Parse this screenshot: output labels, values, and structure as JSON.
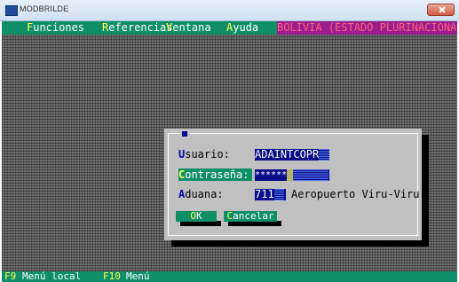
{
  "window": {
    "title": "MODBRILDE"
  },
  "menu": {
    "items": [
      {
        "hotkey": "F",
        "rest": "unciones"
      },
      {
        "hotkey": "R",
        "rest": "eferencias"
      },
      {
        "hotkey": "V",
        "rest": "entana"
      },
      {
        "hotkey": "A",
        "rest": "yuda"
      }
    ],
    "banner": "BOLIVIA (ESTADO PLURINACIONAL DE)"
  },
  "login": {
    "usuario_hotkey": "U",
    "usuario_label": "suario:",
    "usuario_value": "ADAINTCOPR",
    "contrasena_hotkey": "C",
    "contrasena_label": "ontraseña:",
    "contrasena_value": "******",
    "aduana_hotkey": "A",
    "aduana_label": "duana:",
    "aduana_code": "711",
    "aduana_name": "Aeropuerto Viru-Viru",
    "ok_hotkey": "O",
    "ok_rest": "K",
    "cancel_hotkey": "C",
    "cancel_rest": "ancelar"
  },
  "status": {
    "items": [
      {
        "key": "F9",
        "label": "Menú local"
      },
      {
        "key": "F10",
        "label": "Menú"
      }
    ]
  },
  "colors": {
    "bar_green": "#0f8f67",
    "field_blue": "#0a0a8a",
    "dialog_gray": "#c0c0c0",
    "hotkey_yellow": "#ffff55",
    "banner_magenta": "#9c1e8d"
  }
}
